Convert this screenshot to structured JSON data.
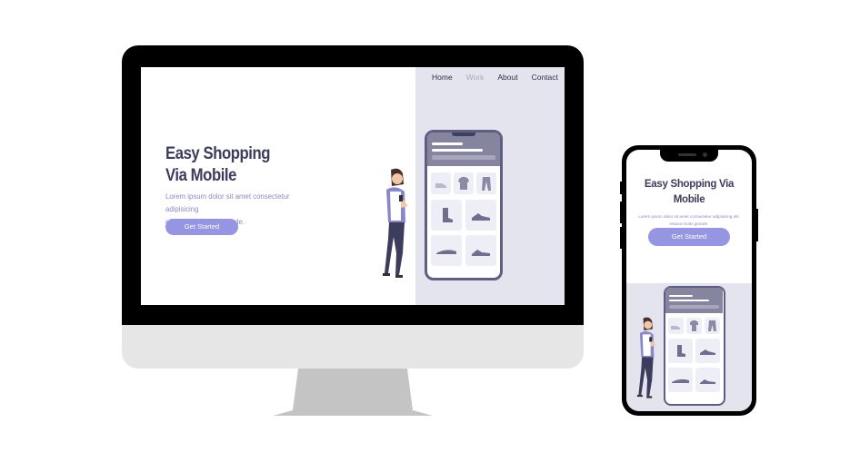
{
  "desktop": {
    "nav": {
      "items": [
        {
          "label": "Home"
        },
        {
          "label": "Work"
        },
        {
          "label": "About"
        },
        {
          "label": "Contact"
        }
      ]
    },
    "hero": {
      "title_line1": "Easy Shopping",
      "title_line2": "Via Mobile",
      "body_line1": "Lorem ipsum dolor sit amet consectetur adipisicing",
      "body_line2": "elit. estava muito grande.",
      "cta_label": "Get Started"
    }
  },
  "mobile": {
    "hero": {
      "title_line1": "Easy Shopping Via",
      "title_line2": "Mobile",
      "body_line1": "Lorem ipsum dolor sit amet consectetur adipisicing elit.",
      "body_line2": "estava muito grande.",
      "cta_label": "Get Started"
    }
  },
  "colors": {
    "accent": "#9595e2",
    "panel": "#e4e4ef",
    "phone_frame": "#5e5e84",
    "heading": "#3c3c5c"
  },
  "icons": [
    "shoe-icon",
    "tshirt-icon",
    "pants-icon",
    "boot-icon",
    "sneaker-icon",
    "slipper-icon",
    "heel-icon",
    "person-illustration"
  ]
}
